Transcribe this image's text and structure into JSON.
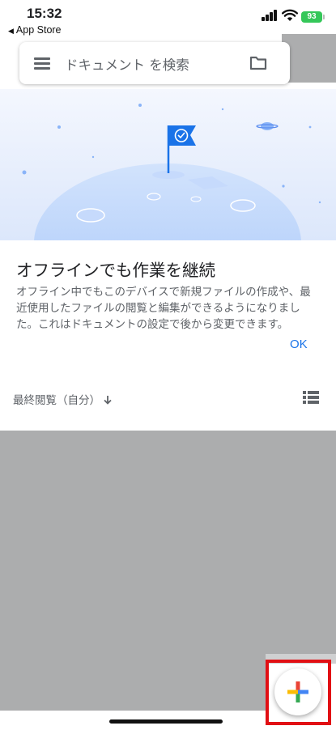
{
  "status_bar": {
    "time": "15:32",
    "back_app_label": "App Store",
    "back_icon": "back-triangle-icon",
    "battery": "93"
  },
  "search": {
    "placeholder": "ドキュメント を検索",
    "menu_icon": "hamburger-menu-icon",
    "folder_icon": "folder-icon"
  },
  "offline_card": {
    "title": "オフラインでも作業を継続",
    "body": "オフライン中でもこのデバイスで新規ファイルの作成や、最近使用したファイルの閲覧と編集ができるようになりました。これはドキュメントの設定で後から変更できます。",
    "ok_label": "OK"
  },
  "file_list": {
    "sort_label": "最終閲覧（自分）",
    "sort_icon": "arrow-down-icon",
    "view_icon": "list-view-icon"
  },
  "fab": {
    "icon": "plus-icon",
    "colors": [
      "#ea4335",
      "#34a853",
      "#fbbc04",
      "#4285f4"
    ],
    "highlight_color": "#e10f14"
  },
  "colors": {
    "accent": "#1a73e8",
    "overlay_gray": "#acadae",
    "illustration_sky": "#e8f0fe",
    "planet": "#a8c7fa"
  }
}
